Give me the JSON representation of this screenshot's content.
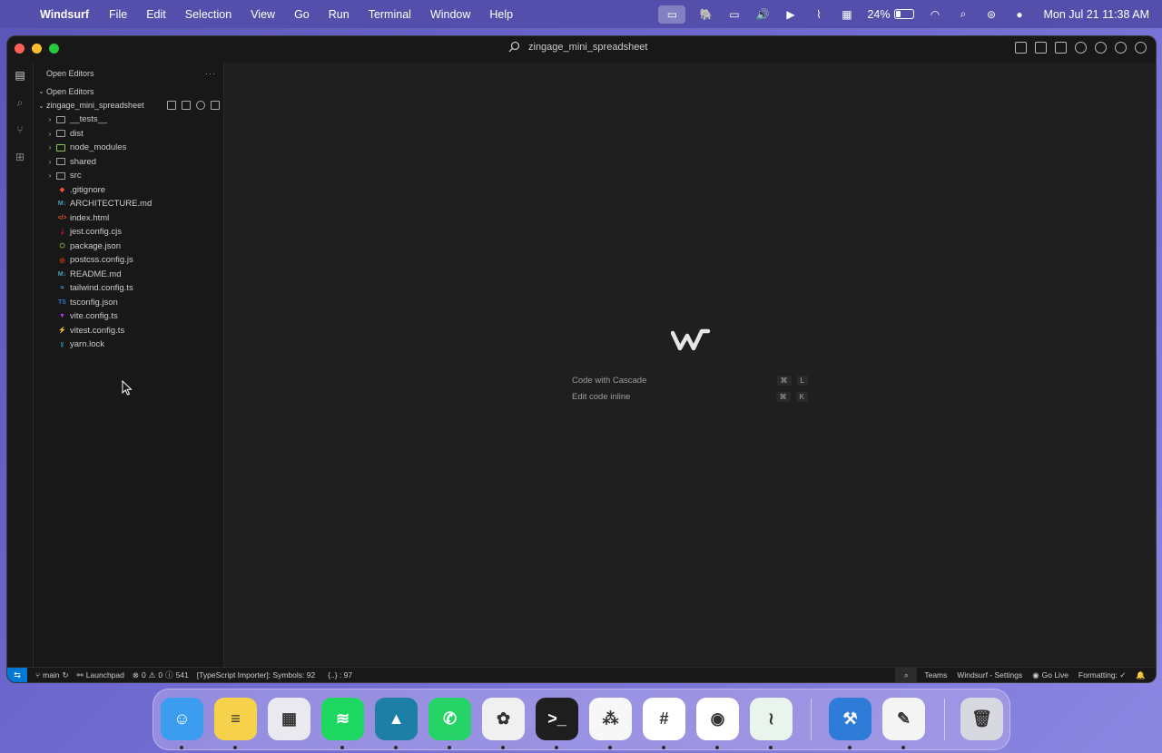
{
  "menubar": {
    "app_name": "Windsurf",
    "items": [
      "File",
      "Edit",
      "Selection",
      "View",
      "Go",
      "Run",
      "Terminal",
      "Window",
      "Help"
    ],
    "battery_percent": "24%",
    "datetime": "Mon Jul 21  11:38 AM",
    "status_icons": [
      "screen-share-icon",
      "elephant-icon",
      "display-icon",
      "volume-icon",
      "play-icon",
      "network-icon",
      "calendar-icon",
      "battery-icon",
      "wifi-icon",
      "spotlight-icon",
      "control-center-icon",
      "siri-icon"
    ]
  },
  "window": {
    "title": "zingage_mini_spreadsheet"
  },
  "sidebar": {
    "header": "Open Editors",
    "header_more": "···",
    "open_editors_section": "Open Editors",
    "project_name": "zingage_mini_spreadsheet",
    "folders": [
      {
        "name": "__tests__",
        "color": "#a0a0a0"
      },
      {
        "name": "dist",
        "color": "#a0a0a0"
      },
      {
        "name": "node_modules",
        "color": "#8bc34a"
      },
      {
        "name": "shared",
        "color": "#a0a0a0"
      },
      {
        "name": "src",
        "color": "#a0a0a0"
      }
    ],
    "files": [
      {
        "name": ".gitignore",
        "icon": "git-icon",
        "glyph": "◆",
        "color": "#f05133"
      },
      {
        "name": "ARCHITECTURE.md",
        "icon": "markdown-icon",
        "glyph": "M↓",
        "color": "#519aba"
      },
      {
        "name": "index.html",
        "icon": "html-icon",
        "glyph": "</>",
        "color": "#e44d26"
      },
      {
        "name": "jest.config.cjs",
        "icon": "jest-icon",
        "glyph": "ʝ",
        "color": "#c21325"
      },
      {
        "name": "package.json",
        "icon": "npm-icon",
        "glyph": "⬡",
        "color": "#8bc34a"
      },
      {
        "name": "postcss.config.js",
        "icon": "postcss-icon",
        "glyph": "◎",
        "color": "#dd3a0a"
      },
      {
        "name": "README.md",
        "icon": "markdown-icon",
        "glyph": "M↓",
        "color": "#519aba"
      },
      {
        "name": "tailwind.config.ts",
        "icon": "tailwind-icon",
        "glyph": "≈",
        "color": "#38bdf8"
      },
      {
        "name": "tsconfig.json",
        "icon": "typescript-icon",
        "glyph": "TS",
        "color": "#3178c6"
      },
      {
        "name": "vite.config.ts",
        "icon": "vite-icon",
        "glyph": "▼",
        "color": "#bd34fe"
      },
      {
        "name": "vitest.config.ts",
        "icon": "vitest-icon",
        "glyph": "⚡",
        "color": "#fcc72b"
      },
      {
        "name": "yarn.lock",
        "icon": "yarn-icon",
        "glyph": "ɣ",
        "color": "#2c8ebb"
      }
    ]
  },
  "editor": {
    "hints": [
      {
        "label": "Code with Cascade",
        "keys": [
          "⌘",
          "L"
        ]
      },
      {
        "label": "Edit code inline",
        "keys": [
          "⌘",
          "K"
        ]
      }
    ]
  },
  "statusbar": {
    "branch": "main",
    "launchpad": "Launchpad",
    "errors": "0",
    "warnings": "0",
    "info": "541",
    "importer": "[TypeScript Importer]: Symbols: 92",
    "braces": "{..} : 97",
    "teams": "Teams",
    "settings": "Windsurf - Settings",
    "go_live": "Go Live",
    "formatting": "Formatting: ✓"
  },
  "dock": {
    "apps": [
      {
        "name": "finder-icon",
        "color": "#3b9cf0",
        "glyph": "☺",
        "running": true
      },
      {
        "name": "notes-icon",
        "color": "#f5d24a",
        "glyph": "≡",
        "running": true
      },
      {
        "name": "launchpad-icon",
        "color": "#e9e9ef",
        "glyph": "▦",
        "running": false
      },
      {
        "name": "spotify-icon",
        "color": "#1ed760",
        "glyph": "≋",
        "running": true
      },
      {
        "name": "drive-icon",
        "color": "#1e7fa6",
        "glyph": "▲",
        "running": true
      },
      {
        "name": "whatsapp-icon",
        "color": "#25d366",
        "glyph": "✆",
        "running": true
      },
      {
        "name": "chatgpt-icon",
        "color": "#f0f0f0",
        "glyph": "✿",
        "running": true
      },
      {
        "name": "terminal-icon",
        "color": "#1e1e1e",
        "glyph": ">_",
        "running": true
      },
      {
        "name": "asana-icon",
        "color": "#f7f7f7",
        "glyph": "⁂",
        "running": true
      },
      {
        "name": "slack-icon",
        "color": "#ffffff",
        "glyph": "#",
        "running": true
      },
      {
        "name": "chrome-icon",
        "color": "#ffffff",
        "glyph": "◉",
        "running": true
      },
      {
        "name": "windsurf-icon",
        "color": "#e8f4ec",
        "glyph": "≀",
        "running": true
      },
      {
        "name": "xcode-icon",
        "color": "#2f7bd8",
        "glyph": "⚒",
        "running": true
      },
      {
        "name": "textedit-icon",
        "color": "#f4f4f4",
        "glyph": "✎",
        "running": true
      },
      {
        "name": "trash-icon",
        "color": "#d8d8e0",
        "glyph": "🗑",
        "running": false
      }
    ]
  }
}
